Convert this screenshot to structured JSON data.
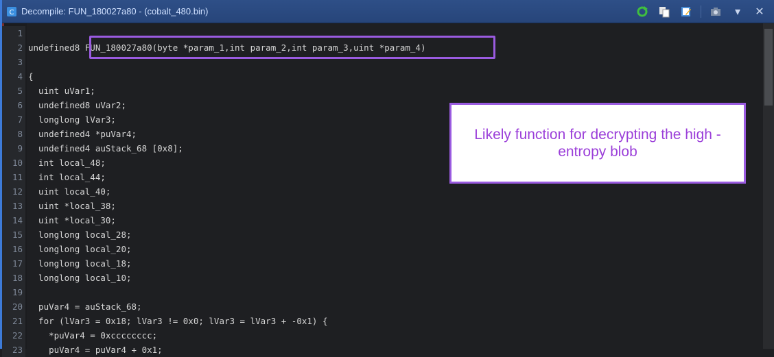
{
  "window": {
    "title": "Decompile: FUN_180027a80 -  (cobalt_480.bin)",
    "accent_color": "#9a5be0"
  },
  "toolbar": {
    "icons": [
      "refresh-icon",
      "copy-icon",
      "edit-icon",
      "snapshot-icon",
      "dropdown-icon",
      "close-icon"
    ],
    "dropdown_glyph": "▾",
    "close_glyph": "✕"
  },
  "code": {
    "lines": [
      {
        "num": "1",
        "text": ""
      },
      {
        "num": "2",
        "text": "undefined8 FUN_180027a80(byte *param_1,int param_2,int param_3,uint *param_4)"
      },
      {
        "num": "3",
        "text": ""
      },
      {
        "num": "4",
        "text": "{"
      },
      {
        "num": "5",
        "text": "  uint uVar1;"
      },
      {
        "num": "6",
        "text": "  undefined8 uVar2;"
      },
      {
        "num": "7",
        "text": "  longlong lVar3;"
      },
      {
        "num": "8",
        "text": "  undefined4 *puVar4;"
      },
      {
        "num": "9",
        "text": "  undefined4 auStack_68 [0x8];"
      },
      {
        "num": "10",
        "text": "  int local_48;"
      },
      {
        "num": "11",
        "text": "  int local_44;"
      },
      {
        "num": "12",
        "text": "  uint local_40;"
      },
      {
        "num": "13",
        "text": "  uint *local_38;"
      },
      {
        "num": "14",
        "text": "  uint *local_30;"
      },
      {
        "num": "15",
        "text": "  longlong local_28;"
      },
      {
        "num": "16",
        "text": "  longlong local_20;"
      },
      {
        "num": "17",
        "text": "  longlong local_18;"
      },
      {
        "num": "18",
        "text": "  longlong local_10;"
      },
      {
        "num": "19",
        "text": ""
      },
      {
        "num": "20",
        "text": "  puVar4 = auStack_68;"
      },
      {
        "num": "21",
        "text": "  for (lVar3 = 0x18; lVar3 != 0x0; lVar3 = lVar3 + -0x1) {"
      },
      {
        "num": "22",
        "text": "    *puVar4 = 0xcccccccc;"
      },
      {
        "num": "23",
        "text": "    puVar4 = puVar4 + 0x1;"
      }
    ]
  },
  "annotation": {
    "callout_text": "Likely function for decrypting the high -entropy blob"
  }
}
